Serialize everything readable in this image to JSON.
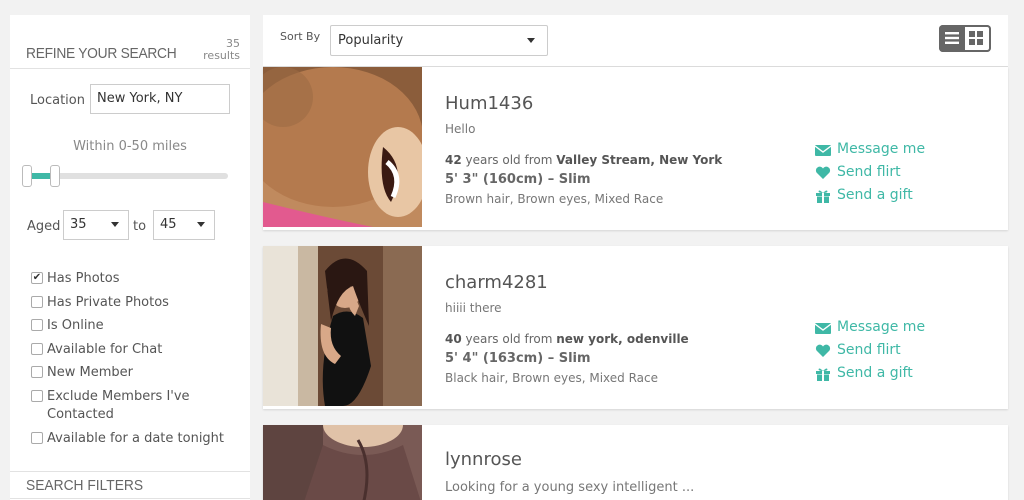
{
  "sidebar": {
    "title": "REFINE YOUR SEARCH",
    "results_count": "35",
    "results_word": "results",
    "location_label": "Location",
    "location_value": "New York, NY",
    "within": "Within 0-50 miles",
    "distance_range_miles": [
      0,
      50
    ],
    "aged_label": "Aged",
    "age_min": "35",
    "age_to": "to",
    "age_max": "45",
    "checkboxes": [
      {
        "label": "Has Photos",
        "checked": true
      },
      {
        "label": "Has Private Photos",
        "checked": false
      },
      {
        "label": "Is Online",
        "checked": false
      },
      {
        "label": "Available for Chat",
        "checked": false
      },
      {
        "label": "New Member",
        "checked": false
      },
      {
        "label": "Exclude Members I've",
        "label2": "Contacted",
        "checked": false
      },
      {
        "label": "Available for a date tonight",
        "checked": false
      }
    ],
    "filters_title": "SEARCH FILTERS"
  },
  "topbar": {
    "sort_label": "Sort By",
    "sort_value": "Popularity",
    "view_icons": [
      "list-view-icon",
      "grid-view-icon"
    ]
  },
  "profiles": [
    {
      "username": "Hum1436",
      "tagline": "Hello",
      "age": "42",
      "age_suffix": "years old from",
      "location": "Valley Stream, New York",
      "body": "5' 3\" (160cm) – Slim",
      "looks": "Brown hair, Brown eyes, Mixed Race"
    },
    {
      "username": "charm4281",
      "tagline": "hiiii there",
      "age": "40",
      "age_suffix": "years old from",
      "location": "new york, odenville",
      "body": "5' 4\" (163cm) – Slim",
      "looks": "Black hair, Brown eyes, Mixed Race"
    },
    {
      "username": "lynnrose",
      "tagline": "Looking for a young sexy intelligent ..."
    }
  ],
  "actions": {
    "message": "Message me",
    "flirt": "Send flirt",
    "gift": "Send a gift"
  },
  "colors": {
    "accent": "#3fb8a6",
    "background": "#f2f2f2"
  }
}
